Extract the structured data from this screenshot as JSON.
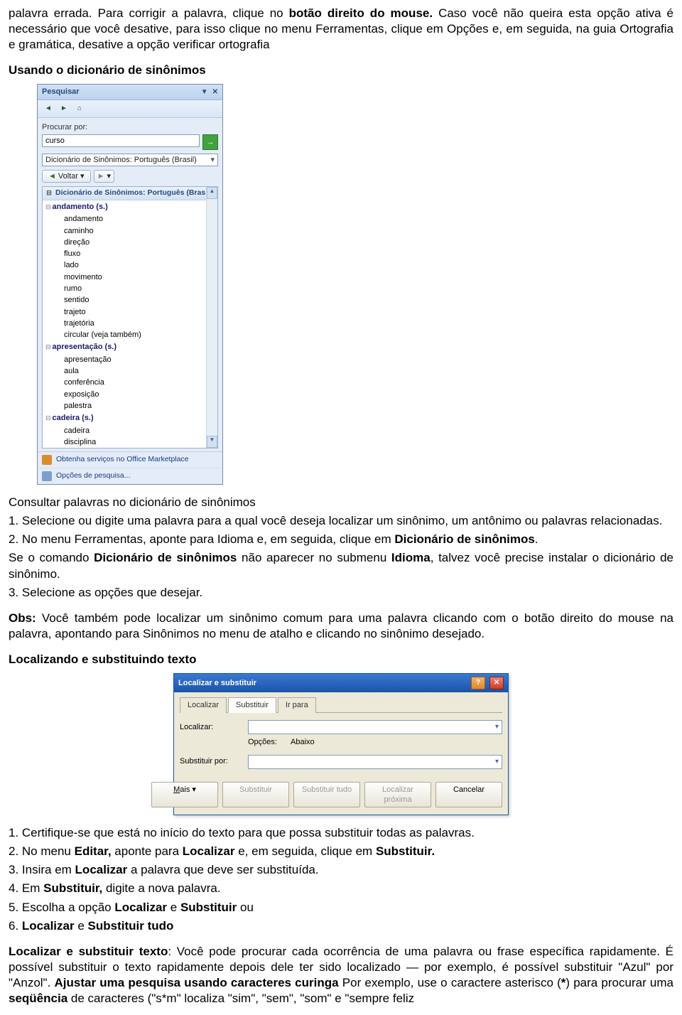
{
  "intro": {
    "p1_a": "palavra errada. Para corrigir a palavra, clique no ",
    "p1_b": "botão direito do mouse.",
    "p1_c": " Caso você não queira esta opção ativa é necessário que você desative, para isso clique no menu Ferramentas, clique em Opções e, em seguida, na guia Ortografia e gramática, desative a opção verificar ortografia"
  },
  "sec1": {
    "heading": "Usando o dicionário de sinônimos",
    "panel": {
      "title": "Pesquisar",
      "procurar_label": "Procurar por:",
      "procurar_value": "curso",
      "dict_select": "Dicionário de Sinônimos: Português (Brasil)",
      "voltar": "Voltar",
      "results_header": "Dicionário de Sinônimos: Português (Brasil)",
      "groups": [
        {
          "head": "andamento (s.)",
          "items": [
            "andamento",
            "caminho",
            "direção",
            "fluxo",
            "lado",
            "movimento",
            "rumo",
            "sentido",
            "trajeto",
            "trajetória",
            "circular (veja também)"
          ]
        },
        {
          "head": "apresentação (s.)",
          "items": [
            "apresentação",
            "aula",
            "conferência",
            "exposição",
            "palestra"
          ]
        },
        {
          "head": "cadeira (s.)",
          "items": [
            "cadeira",
            "disciplina"
          ]
        }
      ],
      "footer_marketplace": "Obtenha serviços no Office Marketplace",
      "footer_options": "Opções de pesquisa..."
    },
    "after_panel": "Consultar palavras no dicionário de sinônimos",
    "li1": "1. Selecione ou digite uma palavra para a qual você deseja localizar um sinônimo, um antônimo ou palavras relacionadas.",
    "li2_a": "2. No menu Ferramentas, aponte para Idioma e, em seguida, clique em ",
    "li2_b": "Dicionário de sinônimos",
    "li2_c": ".",
    "li2_ex_a": "Se o comando ",
    "li2_ex_b": "Dicionário de sinônimos",
    "li2_ex_c": " não aparecer no submenu ",
    "li2_ex_d": "Idioma",
    "li2_ex_e": ", talvez você precise instalar o dicionário de sinônimo.",
    "li3": "3. Selecione as opções que desejar.",
    "obs_label": "Obs:",
    "obs_text": " Você também pode localizar um sinônimo comum para uma palavra clicando com o botão direito do mouse na palavra, apontando para Sinônimos no menu de atalho e clicando no sinônimo desejado."
  },
  "sec2": {
    "heading": "Localizando e substituindo texto",
    "dialog": {
      "title": "Localizar e substituir",
      "tabs": [
        "Localizar",
        "Substituir",
        "Ir para"
      ],
      "active_tab": "Substituir",
      "find_label": "Localizar:",
      "options_label": "Opções:",
      "options_value": "Abaixo",
      "replace_label": "Substituir por:",
      "buttons": {
        "more": "Mais",
        "replace": "Substituir",
        "replace_all": "Substituir tudo",
        "find_next": "Localizar próxima",
        "cancel": "Cancelar"
      }
    },
    "li1": "1. Certifique-se que está no início do texto para que possa substituir todas as palavras.",
    "li2_a": "2. No menu ",
    "li2_b": "Editar,",
    "li2_c": " aponte para ",
    "li2_d": "Localizar",
    "li2_e": " e, em seguida, clique em ",
    "li2_f": "Substituir.",
    "li3_a": "3. Insira em ",
    "li3_b": "Localizar",
    "li3_c": " a palavra que deve ser substituída.",
    "li4_a": "4. Em ",
    "li4_b": "Substituir,",
    "li4_c": " digite a nova palavra.",
    "li5_a": "5. Escolha a opção ",
    "li5_b": "Localizar",
    "li5_c": " e ",
    "li5_d": "Substituir",
    "li5_e": " ou",
    "li6_a": "6. ",
    "li6_b": "Localizar",
    "li6_c": " e ",
    "li6_d": "Substituir tudo",
    "para_a": "Localizar e substituir texto",
    "para_b": ": Você pode procurar cada ocorrência de uma palavra ou frase específica rapidamente. É possível substituir o texto rapidamente depois dele ter sido localizado — por exemplo, é possível substituir \"Azul\" por \"Anzol\". ",
    "para_c": "Ajustar uma pesquisa usando caracteres curinga",
    "para_d": " Por exemplo, use o caractere asterisco (",
    "para_e": "*",
    "para_f": ") para procurar uma ",
    "para_g": "seqüência",
    "para_h": " de caracteres (\"s*m\" localiza \"sim\", \"sem\", \"som\" e \"sempre feliz"
  }
}
